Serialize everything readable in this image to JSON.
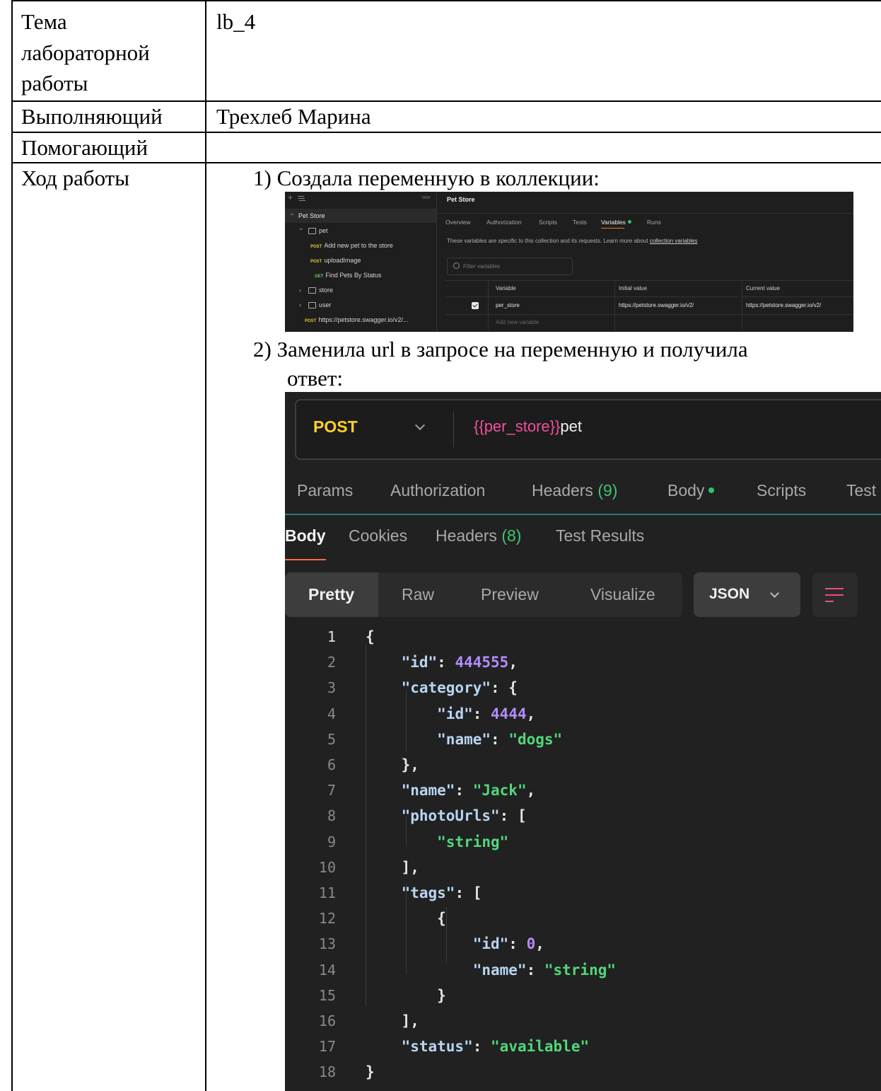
{
  "table": {
    "rows": [
      {
        "label_lines": [
          "Тема",
          "лабораторной",
          "работы"
        ],
        "value": "lb_4"
      },
      {
        "label": "Выполняющий",
        "value": "Трехлеб Марина"
      },
      {
        "label": "Помогающий",
        "value": ""
      },
      {
        "label": "Ход работы"
      }
    ]
  },
  "steps": {
    "step1": "1) Создала переменную в коллекции:",
    "step2_line1": "2) Заменила url в запросе на переменную и получила",
    "step2_line2": "ответ:"
  },
  "screenshot1": {
    "sidebar": {
      "plus": "+",
      "filter_icon": "filter-icon",
      "more": "ooo",
      "items": [
        {
          "chevron": "⌄",
          "label": "Pet Store",
          "selected": true
        },
        {
          "chevron": "⌄",
          "label": "pet",
          "icon": "folder-icon"
        },
        {
          "method": "POST",
          "label": "Add new pet to the store"
        },
        {
          "method": "POST",
          "label": "uploadImage"
        },
        {
          "method": "GET",
          "label": "Find Pets By Status"
        },
        {
          "chevron": "›",
          "label": "store",
          "icon": "folder-icon"
        },
        {
          "chevron": "›",
          "label": "user",
          "icon": "folder-icon"
        },
        {
          "method": "POST",
          "label": "https://petstore.swagger.io/v2/..."
        }
      ]
    },
    "title": "Pet Store",
    "tabs": [
      "Overview",
      "Authorization",
      "Scripts",
      "Tests",
      "Variables",
      "Runs"
    ],
    "active_tab": "Variables",
    "description": "These variables are specific to this collection and its requests. Learn more about",
    "description_link": "collection variables",
    "filter_placeholder": "Filter variables",
    "columns": [
      "Variable",
      "Initial value",
      "Current value"
    ],
    "variable": {
      "name": "per_store",
      "initial": "https://petstore.swagger.io/v2/",
      "current": "https://petstore.swagger.io/v2/",
      "checked": true
    },
    "add_placeholder": "Add new variable"
  },
  "screenshot2": {
    "method": "POST",
    "url_var": "{{per_store}}",
    "url_rest": "pet",
    "request_tabs": {
      "params": "Params",
      "authorization": "Authorization",
      "headers": "Headers",
      "headers_count": "(9)",
      "body": "Body",
      "scripts": "Scripts",
      "tests": "Test"
    },
    "response_tabs": {
      "body": "Body",
      "cookies": "Cookies",
      "headers": "Headers",
      "headers_count": "(8)",
      "test_results": "Test Results"
    },
    "formats": [
      "Pretty",
      "Raw",
      "Preview",
      "Visualize"
    ],
    "language": "JSON",
    "wrap_icon": "wrap-lines-icon",
    "code_lines": [
      {
        "n": "1",
        "t": "{"
      },
      {
        "n": "2",
        "t": "    \"id\": 444555,"
      },
      {
        "n": "3",
        "t": "    \"category\": {"
      },
      {
        "n": "4",
        "t": "        \"id\": 4444,"
      },
      {
        "n": "5",
        "t": "        \"name\": \"dogs\""
      },
      {
        "n": "6",
        "t": "    },"
      },
      {
        "n": "7",
        "t": "    \"name\": \"Jack\","
      },
      {
        "n": "8",
        "t": "    \"photoUrls\": ["
      },
      {
        "n": "9",
        "t": "        \"string\""
      },
      {
        "n": "10",
        "t": "    ],"
      },
      {
        "n": "11",
        "t": "    \"tags\": ["
      },
      {
        "n": "12",
        "t": "        {"
      },
      {
        "n": "13",
        "t": "            \"id\": 0,"
      },
      {
        "n": "14",
        "t": "            \"name\": \"string\""
      },
      {
        "n": "15",
        "t": "        }"
      },
      {
        "n": "16",
        "t": "    ],"
      },
      {
        "n": "17",
        "t": "    \"status\": \"available\""
      },
      {
        "n": "18",
        "t": "}"
      }
    ]
  }
}
